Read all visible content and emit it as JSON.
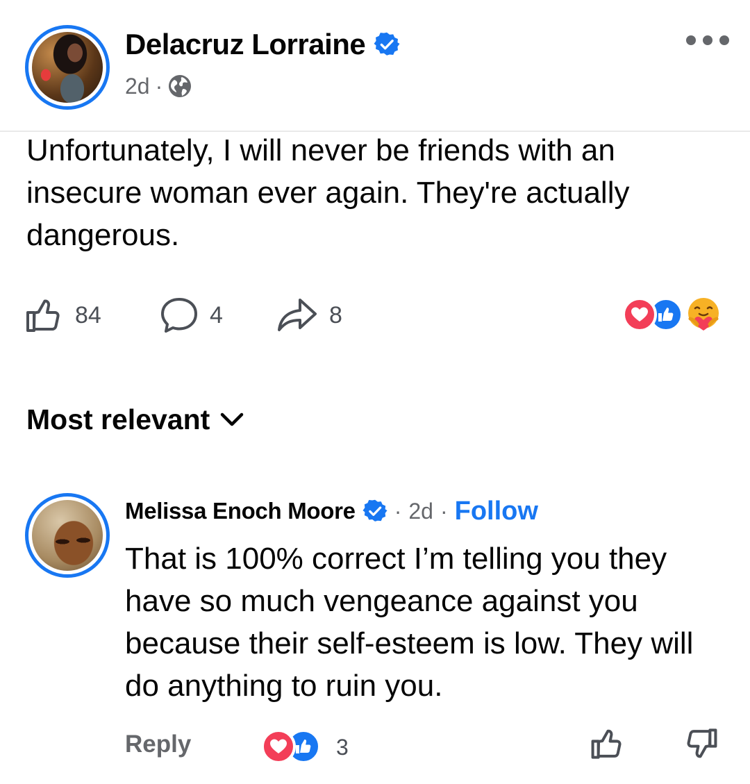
{
  "post": {
    "author": "Delacruz Lorraine",
    "time": "2d",
    "separator": "·",
    "text": "Unfortunately, I will never be friends with an insecure woman ever again. They're actually dangerous.",
    "likes": "84",
    "comments": "4",
    "shares": "8",
    "reaction_icons": [
      "heart-love-icon",
      "thumbs-up-like-icon",
      "care-hug-icon"
    ]
  },
  "sort": {
    "label": "Most relevant"
  },
  "comment": {
    "author": "Melissa Enoch Moore",
    "separator": "·",
    "time": "2d",
    "separator2": "·",
    "follow": "Follow",
    "text": "That is 100% correct I’m telling you they have so much vengeance against you because their self-esteem is low. They will do anything to ruin you.",
    "reply": "Reply",
    "reaction_count": "3"
  },
  "colors": {
    "accent": "#1877f2",
    "love": "#f33e58",
    "secondary_text": "#65676b"
  }
}
